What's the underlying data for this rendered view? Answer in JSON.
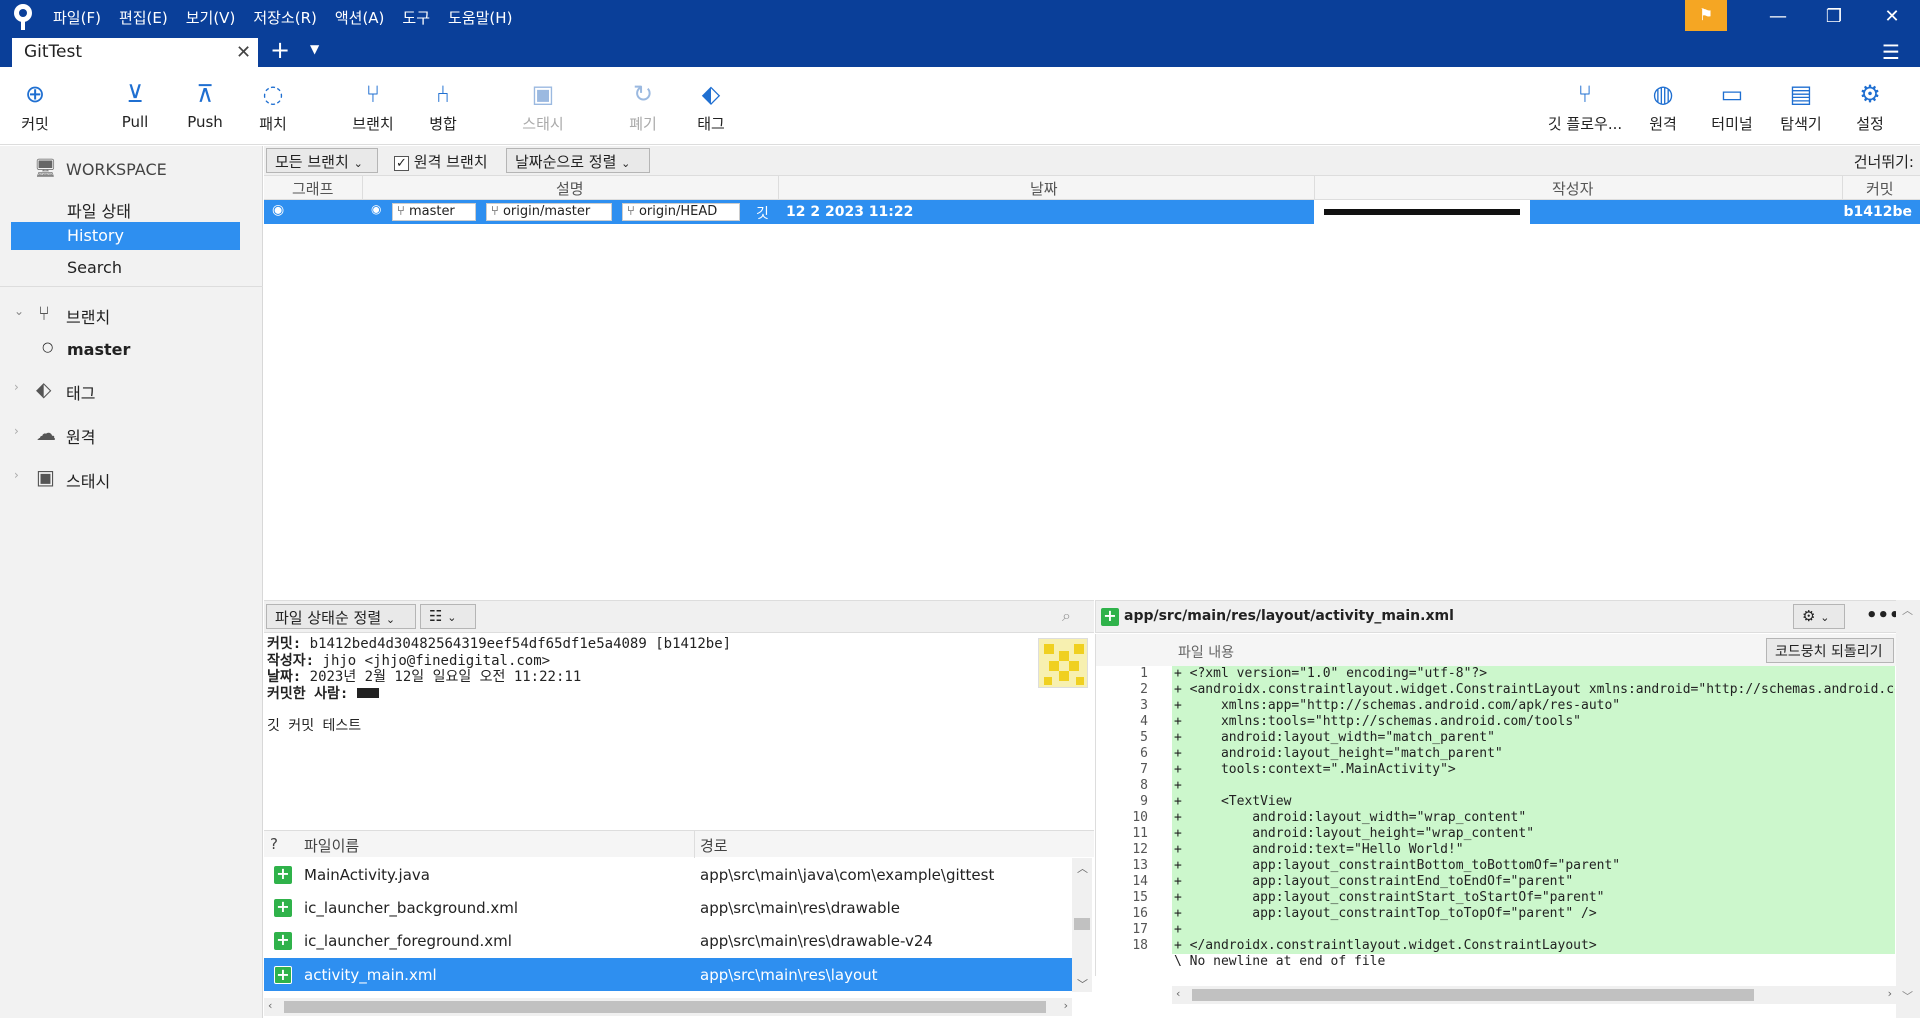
{
  "menu": [
    "파일(F)",
    "편집(E)",
    "보기(V)",
    "저장소(R)",
    "액션(A)",
    "도구",
    "도움말(H)"
  ],
  "tab": {
    "title": "GitTest"
  },
  "toolbar_left": [
    {
      "label": "커밋",
      "icon": "commit-icon"
    },
    {
      "label": "Pull",
      "icon": "pull-icon"
    },
    {
      "label": "Push",
      "icon": "push-icon"
    },
    {
      "label": "패치",
      "icon": "fetch-icon"
    },
    {
      "label": "브랜치",
      "icon": "branch-icon"
    },
    {
      "label": "병합",
      "icon": "merge-icon"
    },
    {
      "label": "스태시",
      "icon": "stash-icon"
    },
    {
      "label": "폐기",
      "icon": "discard-icon"
    },
    {
      "label": "태그",
      "icon": "tag-icon"
    }
  ],
  "toolbar_right": [
    {
      "label": "깃 플로우...",
      "icon": "git-flow-icon"
    },
    {
      "label": "원격",
      "icon": "globe-icon"
    },
    {
      "label": "터미널",
      "icon": "terminal-icon"
    },
    {
      "label": "탐색기",
      "icon": "explorer-icon"
    },
    {
      "label": "설정",
      "icon": "gear-icon"
    }
  ],
  "sidebar": {
    "workspace": "WORKSPACE",
    "items": [
      "파일 상태",
      "History",
      "Search"
    ],
    "branches": "브랜치",
    "current_branch": "master",
    "tags": "태그",
    "remotes": "원격",
    "stashes": "스태시"
  },
  "filter": {
    "branches": "모든 브랜치",
    "remote_branches": "원격 브랜치",
    "sort": "날짜순으로 정렬",
    "skip": "건너뛰기:"
  },
  "columns": {
    "graph": "그래프",
    "desc": "설명",
    "date": "날짜",
    "author": "작성자",
    "commit": "커밋"
  },
  "commit_row": {
    "tags": [
      "master",
      "origin/master",
      "origin/HEAD"
    ],
    "message": "깃",
    "date": "12 2 2023 11:22",
    "hash": "b1412be"
  },
  "bottom_left": {
    "sort": "파일 상태순 정렬",
    "commit_label": "커밋:",
    "commit_value": "b1412bed4d30482564319eef54df65df1e5a4089 [b1412be]",
    "author_label": "작성자:",
    "author_value": "jhjo <jhjo@finedigital.com>",
    "date_label": "날짜:",
    "date_value": "2023년 2월 12일 일요일 오전 11:22:11",
    "committer_label": "커밋한 사람:",
    "message": "깃 커밋 테스트",
    "col_q": "?",
    "col_name": "파일이름",
    "col_path": "경로",
    "files": [
      {
        "name": "MainActivity.java",
        "path": "app\\src\\main\\java\\com\\example\\gittest"
      },
      {
        "name": "ic_launcher_background.xml",
        "path": "app\\src\\main\\res\\drawable"
      },
      {
        "name": "ic_launcher_foreground.xml",
        "path": "app\\src\\main\\res\\drawable-v24"
      },
      {
        "name": "activity_main.xml",
        "path": "app\\src\\main\\res\\layout"
      }
    ]
  },
  "diff": {
    "file": "app/src/main/res/layout/activity_main.xml",
    "hunk": "파일 내용",
    "revert": "코드뭉치 되돌리기",
    "lines": [
      "+ <?xml version=\"1.0\" encoding=\"utf-8\"?>",
      "+ <androidx.constraintlayout.widget.ConstraintLayout xmlns:android=\"http://schemas.android.com/",
      "+     xmlns:app=\"http://schemas.android.com/apk/res-auto\"",
      "+     xmlns:tools=\"http://schemas.android.com/tools\"",
      "+     android:layout_width=\"match_parent\"",
      "+     android:layout_height=\"match_parent\"",
      "+     tools:context=\".MainActivity\">",
      "+",
      "+     <TextView",
      "+         android:layout_width=\"wrap_content\"",
      "+         android:layout_height=\"wrap_content\"",
      "+         android:text=\"Hello World!\"",
      "+         app:layout_constraintBottom_toBottomOf=\"parent\"",
      "+         app:layout_constraintEnd_toEndOf=\"parent\"",
      "+         app:layout_constraintStart_toStartOf=\"parent\"",
      "+         app:layout_constraintTop_toTopOf=\"parent\" />",
      "+",
      "+ </androidx.constraintlayout.widget.ConstraintLayout>"
    ],
    "no_newline": "\\ No newline at end of file"
  }
}
